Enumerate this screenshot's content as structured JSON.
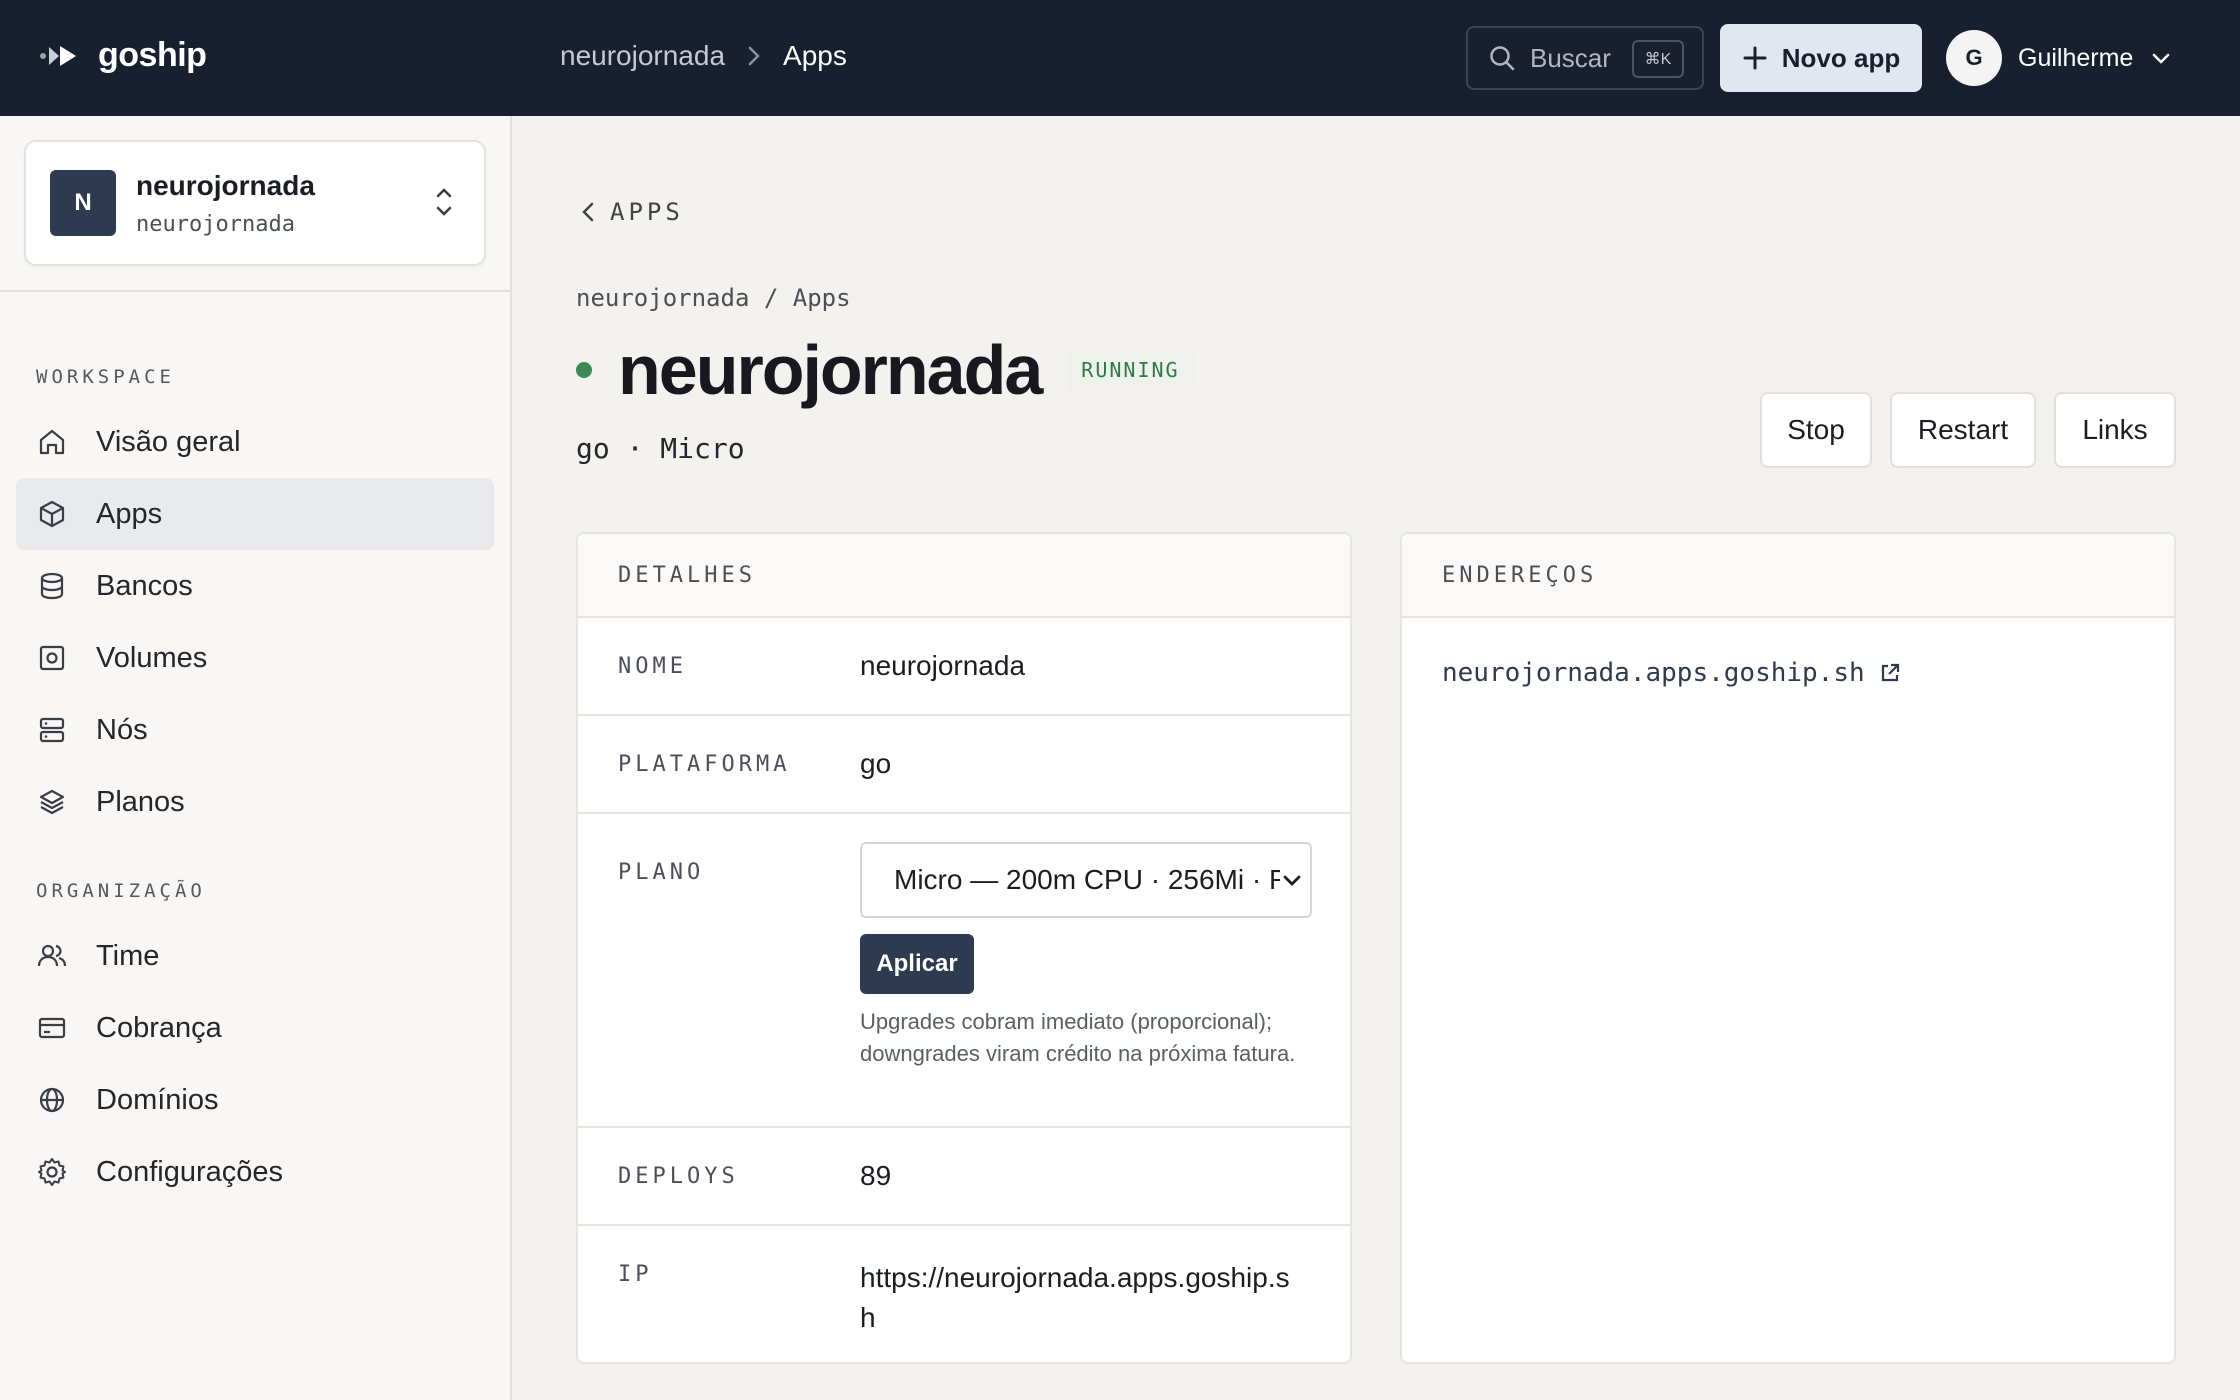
{
  "topbar": {
    "brand": "goship",
    "breadcrumb": [
      "neurojornada",
      "Apps"
    ],
    "search_label": "Buscar",
    "search_shortcut": "⌘K",
    "new_app_label": "Novo app",
    "user_initial": "G",
    "user_name": "Guilherme"
  },
  "sidebar": {
    "workspace": {
      "initial": "N",
      "name": "neurojornada",
      "slug": "neurojornada"
    },
    "workspace_section": "WORKSPACE",
    "workspace_items": [
      {
        "label": "Visão geral",
        "icon": "home-icon"
      },
      {
        "label": "Apps",
        "icon": "box-icon",
        "active": true
      },
      {
        "label": "Bancos",
        "icon": "database-icon"
      },
      {
        "label": "Volumes",
        "icon": "volume-icon"
      },
      {
        "label": "Nós",
        "icon": "server-icon"
      },
      {
        "label": "Planos",
        "icon": "layers-icon"
      }
    ],
    "org_section": "ORGANIZAÇÃO",
    "org_items": [
      {
        "label": "Time",
        "icon": "users-icon"
      },
      {
        "label": "Cobrança",
        "icon": "credit-card-icon"
      },
      {
        "label": "Domínios",
        "icon": "globe-icon"
      },
      {
        "label": "Configurações",
        "icon": "gear-icon"
      }
    ]
  },
  "main": {
    "back_label": "APPS",
    "breadcrumb": "neurojornada / Apps",
    "app_name": "neurojornada",
    "status": "RUNNING",
    "status_color": "#3a8a55",
    "subline": "go · Micro",
    "actions": [
      "Stop",
      "Restart",
      "Links"
    ]
  },
  "details": {
    "title": "DETALHES",
    "nome_label": "NOME",
    "nome_value": "neurojornada",
    "plataforma_label": "PLATAFORMA",
    "plataforma_value": "go",
    "plano_label": "PLANO",
    "plano_selected": "Micro — 200m CPU · 256Mi · R",
    "apply_label": "Aplicar",
    "plano_help": "Upgrades cobram imediato (proporcional); downgrades viram crédito na próxima fatura.",
    "deploys_label": "DEPLOYS",
    "deploys_value": "89",
    "ip_label": "IP",
    "ip_value_line1": "https://neurojornada.apps.goship.s",
    "ip_value_line2": "h"
  },
  "addresses": {
    "title": "ENDEREÇOS",
    "link": "neurojornada.apps.goship.sh"
  }
}
